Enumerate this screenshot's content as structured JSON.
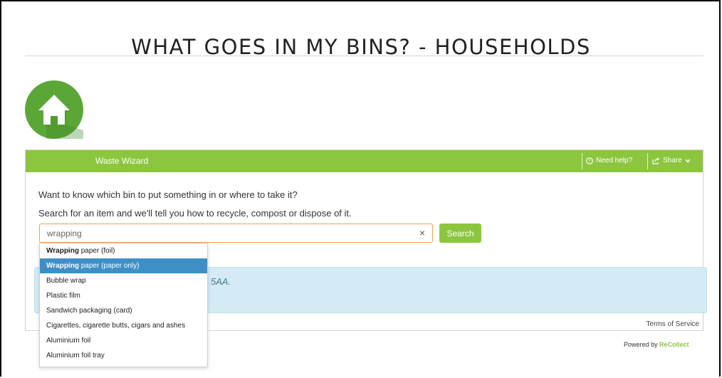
{
  "page": {
    "title": "WHAT GOES IN MY BINS? - HOUSEHOLDS"
  },
  "logo": {
    "icon": "house-icon",
    "color": "#5aa738"
  },
  "widget": {
    "title": "Waste Wizard",
    "help_label": "Need help?",
    "share_label": "Share",
    "intro_line1": "Want to know which bin to put something in or where to take it?",
    "intro_line2": "Search for an item and we'll tell you how to recycle, compost or dispose of it.",
    "search": {
      "value": "wrapping",
      "clear_glyph": "×",
      "button_label": "Search"
    },
    "info_text": "5 5AA.",
    "terms_label": "Terms of Service",
    "accent_color": "#8cc63f"
  },
  "footer": {
    "powered_prefix": "Powered by",
    "powered_brand": "ReCollect"
  },
  "suggestions": [
    {
      "bold": "Wrapping",
      "rest": " paper (foil)",
      "active": false
    },
    {
      "bold": "Wrapping",
      "rest": " paper (paper only)",
      "active": true
    },
    {
      "bold": "",
      "rest": "Bubble wrap",
      "active": false
    },
    {
      "bold": "",
      "rest": "Plastic film",
      "active": false
    },
    {
      "bold": "",
      "rest": "Sandwich packaging (card)",
      "active": false
    },
    {
      "bold": "",
      "rest": "Cigarettes, cigarette butts, cigars and ashes",
      "active": false
    },
    {
      "bold": "",
      "rest": "Aluminium foil",
      "active": false
    },
    {
      "bold": "",
      "rest": "Aluminium foil tray",
      "active": false
    }
  ]
}
